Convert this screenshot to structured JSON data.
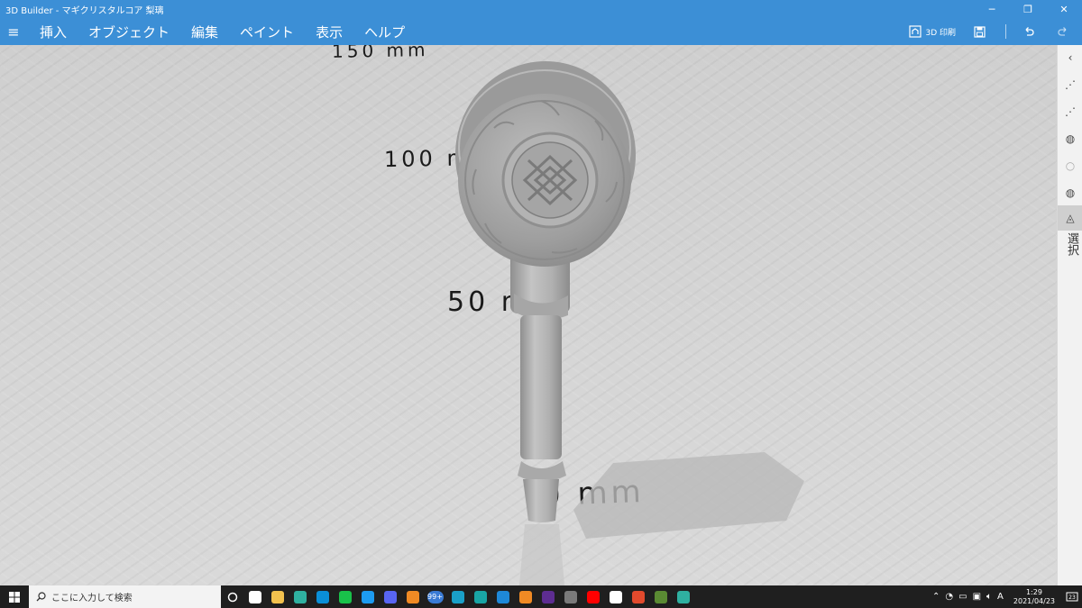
{
  "window": {
    "title": "3D Builder - マギクリスタルコア 梨璃",
    "controls": [
      "minimize-icon",
      "restore-icon",
      "close-icon"
    ]
  },
  "menu": {
    "items": [
      "挿入",
      "オブジェクト",
      "編集",
      "ペイント",
      "表示",
      "ヘルプ"
    ],
    "print_label": "3D 印刷"
  },
  "viewport": {
    "rulers": [
      "150 mm",
      "100 mm",
      "50 mm",
      "0 mm"
    ]
  },
  "rail": {
    "label": "選択",
    "active_index": 6
  },
  "taskbar": {
    "search_placeholder": "ここに入力して検索",
    "badge": "99+",
    "time": "1:29",
    "date": "2021/04/23",
    "ime": "A",
    "notif_count": "23",
    "apps": [
      {
        "name": "task-view",
        "color": "#ffffff"
      },
      {
        "name": "file-explorer",
        "color": "#f2c14e"
      },
      {
        "name": "edge",
        "color": "#2fb0a0"
      },
      {
        "name": "skype",
        "color": "#0a8fd8"
      },
      {
        "name": "line",
        "color": "#19c24a"
      },
      {
        "name": "twitter",
        "color": "#1d9bf0"
      },
      {
        "name": "discord",
        "color": "#5865f2"
      },
      {
        "name": "blender",
        "color": "#f08a24"
      },
      {
        "name": "mail",
        "color": "#3a7bd5"
      },
      {
        "name": "clip",
        "color": "#1aa0c8"
      },
      {
        "name": "arduino",
        "color": "#19a5a5"
      },
      {
        "name": "slicer",
        "color": "#1e88d8"
      },
      {
        "name": "blender-2",
        "color": "#f08a24"
      },
      {
        "name": "music",
        "color": "#5d2d91"
      },
      {
        "name": "media-player",
        "color": "#7a7a7a"
      },
      {
        "name": "youtube",
        "color": "#ff0000"
      },
      {
        "name": "amazon",
        "color": "#ffffff"
      },
      {
        "name": "office",
        "color": "#e24a2d"
      },
      {
        "name": "minecraft",
        "color": "#5a8a33"
      },
      {
        "name": "edge-2",
        "color": "#2fb0a0"
      }
    ]
  },
  "colors": {
    "accent": "#3c8fd6",
    "taskbar": "#1f1f1f",
    "viewport": "#d3d3d3"
  }
}
